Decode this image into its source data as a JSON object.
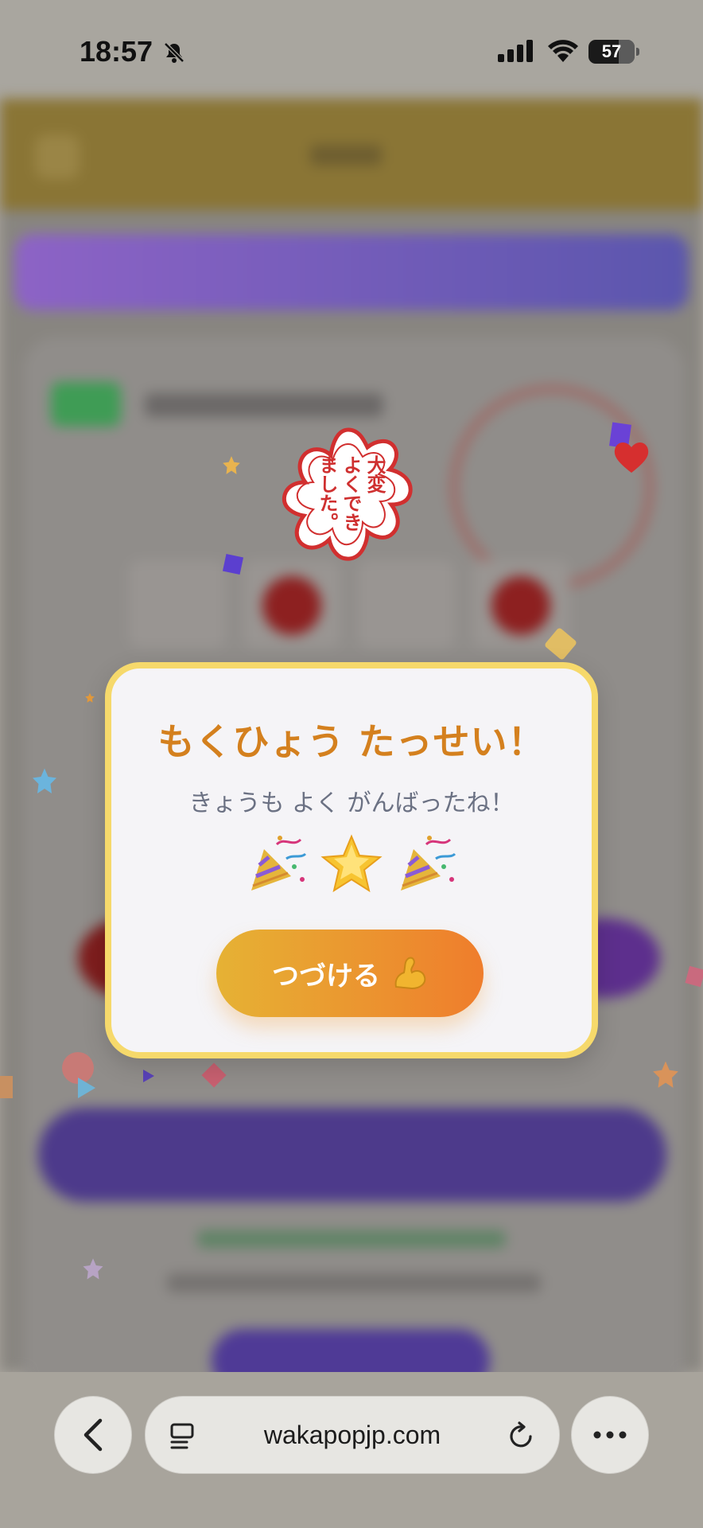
{
  "status_bar": {
    "time": "18:57",
    "battery": "57"
  },
  "stamp": {
    "text": "大変\nよくでき\nました。"
  },
  "modal": {
    "title": "もくひょう たっせい！",
    "subtitle": "きょうも よく がんばったね！",
    "emojis": [
      "party-popper-icon",
      "glowing-star-icon",
      "party-popper-icon"
    ],
    "continue_label": "つづける"
  },
  "browser": {
    "url": "wakapopjp.com"
  },
  "colors": {
    "title": "#d4801e",
    "subtitle": "#6b7183",
    "modal_border": "#f6d96b",
    "button_start": "#e6b234",
    "button_end": "#ef7d2c",
    "stamp_red": "#cf3030"
  }
}
